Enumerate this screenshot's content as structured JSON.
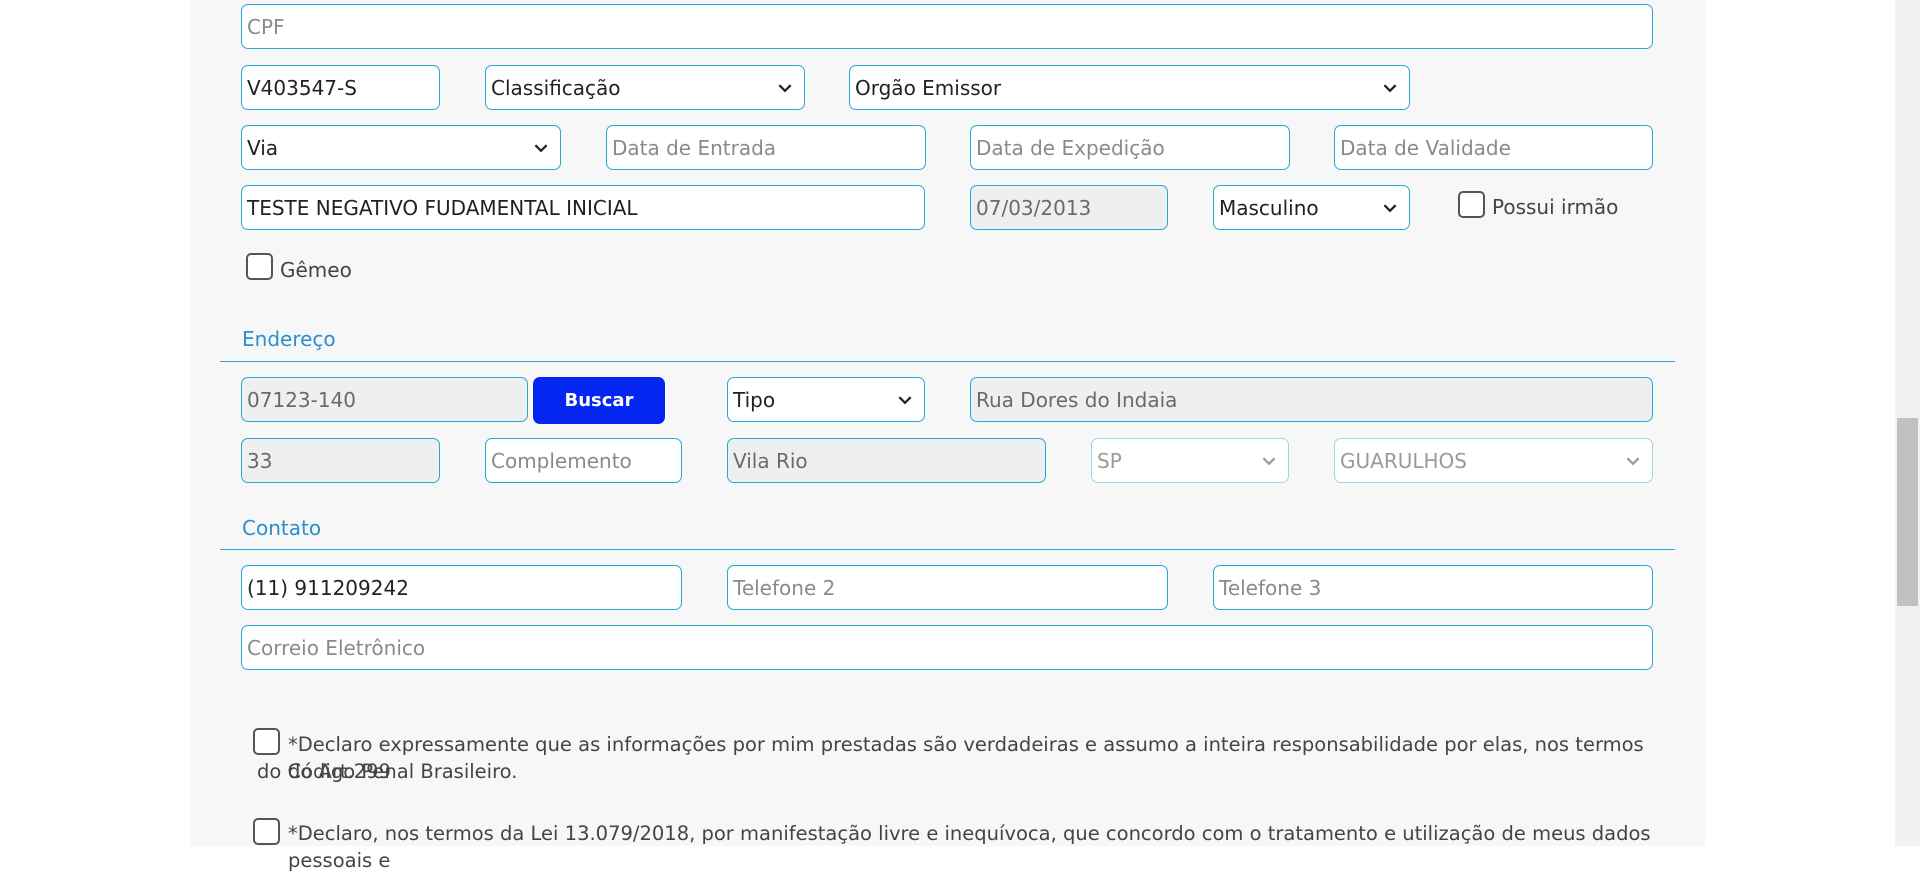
{
  "documents": {
    "cpf_placeholder": "CPF",
    "rg_value": "V403547-S",
    "classificacao": "Classificação",
    "orgao_emissor": "Orgão Emissor",
    "via": "Via",
    "data_entrada_placeholder": "Data de Entrada",
    "data_expedicao_placeholder": "Data de Expedição",
    "data_validade_placeholder": "Data de Validade"
  },
  "person": {
    "name": "TESTE NEGATIVO FUDAMENTAL INICIAL",
    "birth_date": "07/03/2013",
    "sexo": "Masculino",
    "possui_irmao_label": "Possui irmão",
    "gemeo_label": "Gêmeo"
  },
  "endereco": {
    "title": "Endereço",
    "cep": "07123-140",
    "buscar_label": "Buscar",
    "tipo": "Tipo",
    "logradouro": "Rua Dores do Indaia",
    "numero": "33",
    "complemento_placeholder": "Complemento",
    "bairro": "Vila Rio",
    "uf": "SP",
    "cidade": "GUARULHOS"
  },
  "contato": {
    "title": "Contato",
    "telefone1": "(11) 911209242",
    "telefone2_placeholder": "Telefone 2",
    "telefone3_placeholder": "Telefone 3",
    "email_placeholder": "Correio Eletrônico"
  },
  "declarations": {
    "decl1_line1": "*Declaro expressamente que as informações por mim prestadas são verdadeiras e assumo a inteira responsabilidade por elas, nos termos do Art.299",
    "decl1_line2": "do Código Penal Brasileiro.",
    "decl2_line1": "*Declaro, nos termos da Lei 13.079/2018, por manifestação livre e inequívoca, que concordo com o tratamento e utilização de meus dados pessoais e"
  },
  "colors": {
    "accent": "#2aa6d6",
    "section_title": "#2a8fcb",
    "button": "#0525f0"
  }
}
